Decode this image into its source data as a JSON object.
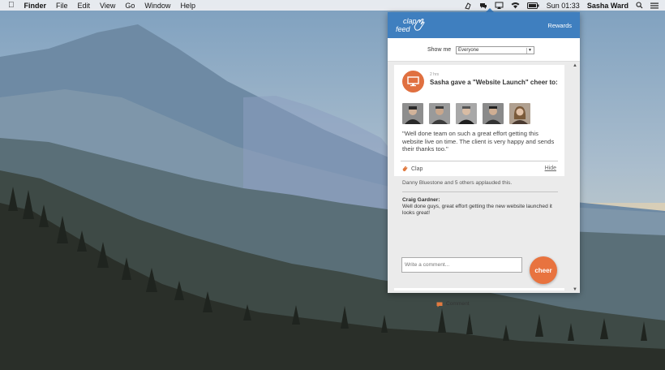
{
  "menubar": {
    "apple_icon": "apple-icon",
    "app_name": "Finder",
    "menus": [
      "File",
      "Edit",
      "View",
      "Go",
      "Window",
      "Help"
    ],
    "clock": "Sun 01:33",
    "user": "Sasha Ward",
    "status_icons": [
      "clapfeed-icon",
      "chat-icon",
      "airplay-icon",
      "wifi-icon",
      "battery-icon",
      "search-icon",
      "list-icon"
    ]
  },
  "app": {
    "logo_top": "clap",
    "logo_bottom": "feed",
    "rewards_label": "Rewards",
    "filter_label": "Show me",
    "filter_value": "Everyone",
    "accent": "#3f7fbf",
    "cheer_color": "#e8733f"
  },
  "post": {
    "time": "2 hrs",
    "headline": "Sasha gave a \"Website Launch\" cheer to:",
    "recipients_count": 5,
    "quote": "\"Well done team on such a great effort getting this website live on time. The client is very happy and sends their thanks too.\"",
    "clap_label": "Clap",
    "comment_label": "Comment",
    "hide_label": "Hide"
  },
  "activity": {
    "applause": "Danny Bluestone and 5 others applauded this.",
    "comment_author": "Craig Gardner:",
    "comment_text": "Well done guys, great effort getting the new website launched it looks great!"
  },
  "composer": {
    "placeholder": "Write a comment...",
    "cheer_label": "cheer"
  }
}
